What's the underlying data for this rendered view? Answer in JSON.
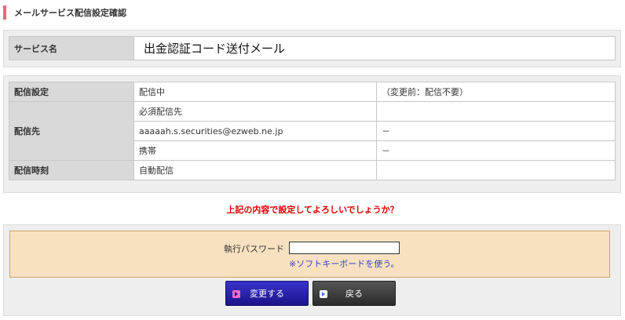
{
  "header": {
    "title": "メールサービス配信設定確認"
  },
  "service": {
    "label": "サービス名",
    "value": "出金認証コード送付メール"
  },
  "delivery": {
    "setting_label": "配信設定",
    "setting_value": "配信中",
    "setting_before": "（変更前：配信不要）",
    "dest_label": "配信先",
    "dest_rows": [
      {
        "value": "必須配信先",
        "before": ""
      },
      {
        "value": "aaaaah.s.securities@ezweb.ne.jp",
        "before": "－"
      },
      {
        "value": "携帯",
        "before": "－"
      }
    ],
    "time_label": "配信時刻",
    "time_value": "自動配信",
    "time_before": ""
  },
  "confirm": {
    "message": "上記の内容で設定してよろしいでしょうか？"
  },
  "password": {
    "label": "執行パスワード",
    "value": "",
    "keyboard_link": "※ソフトキーボードを使う。"
  },
  "buttons": {
    "change_label": "変更する",
    "back_label": "戻る"
  },
  "colors": {
    "accent": "#ee6677",
    "confirm_text": "#e00000",
    "link": "#3344cc",
    "password_bg": "#f8e1c0"
  }
}
